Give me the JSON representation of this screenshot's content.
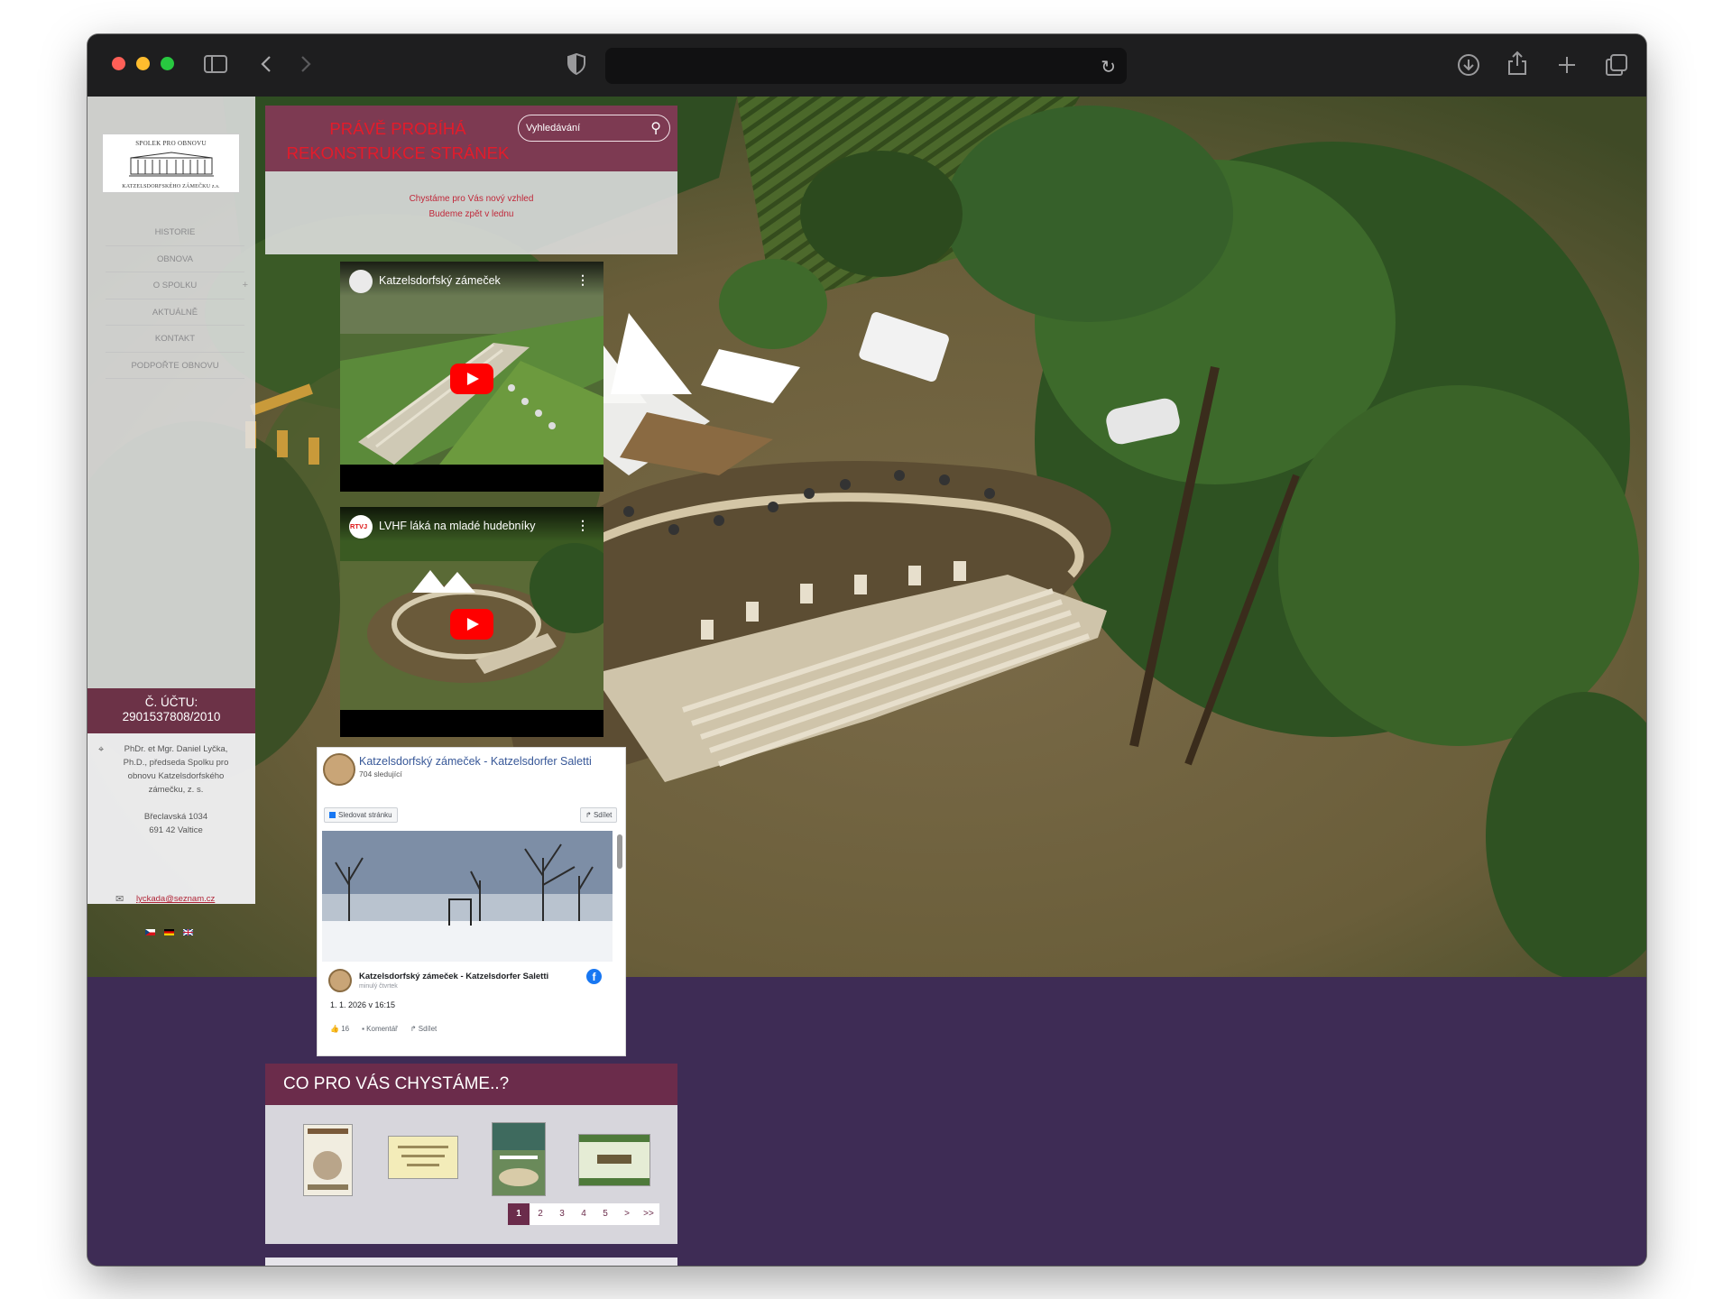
{
  "colors": {
    "accent_wine": "#6b2c4b",
    "notice_red": "#e41b2a",
    "page_purple": "#3e2c55",
    "facebook_blue": "#1877f2"
  },
  "browser": {
    "url": "",
    "icons": [
      "sidebar-toggle-icon",
      "back-icon",
      "forward-icon",
      "shield-icon",
      "reload-icon",
      "download-icon",
      "share-icon",
      "new-tab-icon",
      "tab-overview-icon"
    ]
  },
  "sidebar": {
    "logo": {
      "line1": "SPOLEK PRO OBNOVU",
      "line2": "KATZELSDORFSKÉHO ZÁMEČKU z.s."
    },
    "nav": [
      {
        "label": "HISTORIE"
      },
      {
        "label": "OBNOVA"
      },
      {
        "label": "O SPOLKU",
        "expand": "+"
      },
      {
        "label": "AKTUÁLNĚ"
      },
      {
        "label": "KONTAKT"
      },
      {
        "label": "PODPOŘTE OBNOVU"
      }
    ],
    "account": {
      "label": "Č. ÚČTU:",
      "number": "2901537808/2010"
    },
    "contact": {
      "person": "PhDr. et Mgr. Daniel Lyčka, Ph.D., předseda Spolku pro obnovu Katzelsdorfského zámečku, z. s.",
      "street": "Břeclavská 1034",
      "city": "691 42 Valtice",
      "email": "lyckada@seznam.cz"
    },
    "languages": [
      "cs",
      "de",
      "en"
    ]
  },
  "notice": {
    "title": "PRÁVĚ PROBÍHÁ REKONSTRUKCE STRÁNEK",
    "search_placeholder": "Vyhledávání",
    "line1": "Chystáme pro Vás nový vzhled",
    "line2": "Budeme zpět v lednu"
  },
  "videos": [
    {
      "title": "Katzelsdorfský zámeček"
    },
    {
      "title": "LVHF láká na mladé hudebníky",
      "channel_badge": "RTVJ"
    }
  ],
  "facebook": {
    "page_name": "Katzelsdorfský zámeček - Katzelsdorfer Saletti",
    "followers": "704 sledující",
    "follow_button": "Sledovat stránku",
    "share_button": "Sdílet",
    "post_author": "Katzelsdorfský zámeček - Katzelsdorfer Saletti",
    "post_time": "minulý čtvrtek",
    "post_date": "1. 1. 2026 v 16:15",
    "likes": "16",
    "comment_label": "Komentář",
    "share_label": "Sdílet"
  },
  "chystame": {
    "title": "CO PRO VÁS CHYSTÁME..?",
    "pages": [
      "1",
      "2",
      "3",
      "4",
      "5",
      ">",
      ">>"
    ],
    "active_page": "1"
  }
}
